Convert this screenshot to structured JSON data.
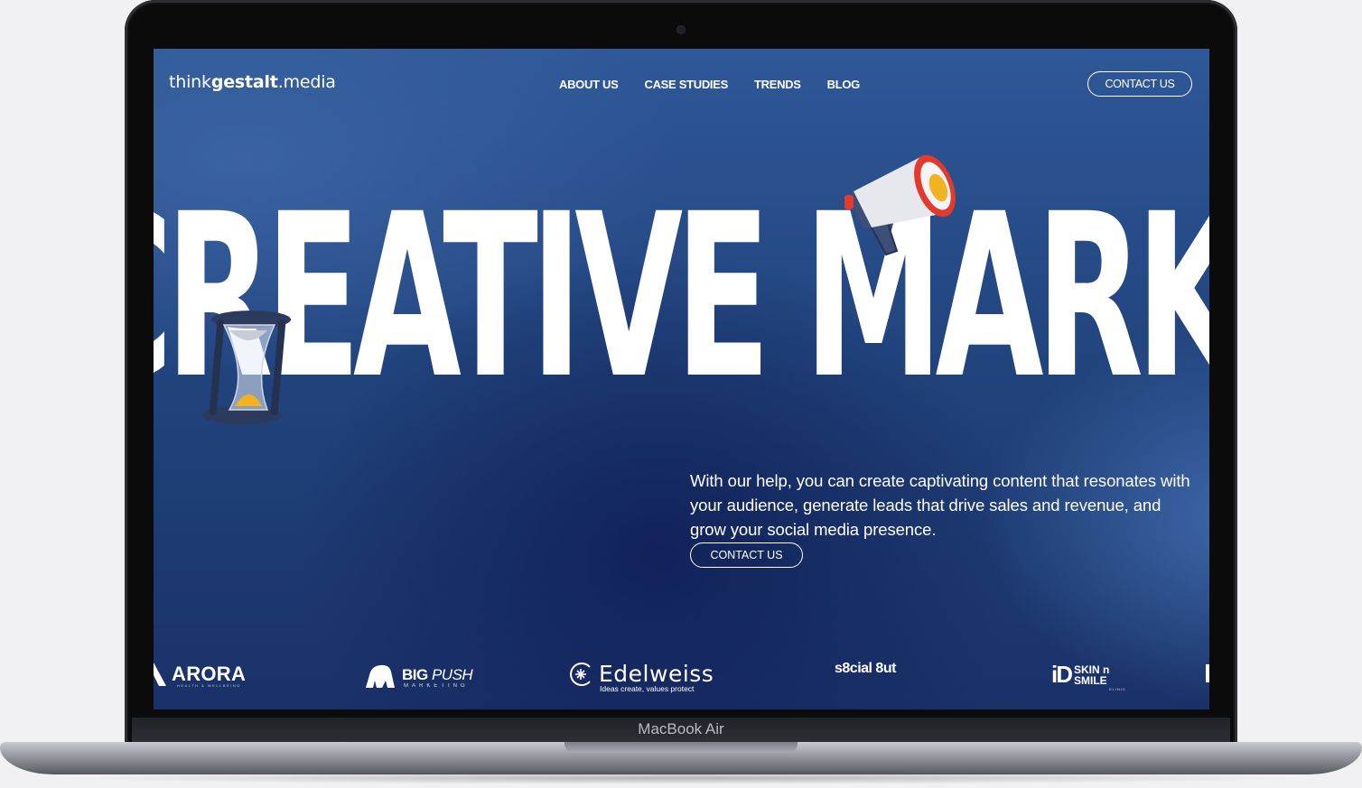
{
  "device": {
    "label": "MacBook Air"
  },
  "header": {
    "brand_prefix": "think",
    "brand_bold": "gestalt",
    "brand_suffix": ".media",
    "nav": [
      "ABOUT US",
      "CASE STUDIES",
      "TRENDS",
      "BLOG"
    ],
    "cta_label": "CONTACT US"
  },
  "hero": {
    "title": "CREATIVE MARKETING",
    "body": "With our help, you can create captivating content that resonates with your audience, generate leads that drive sales and revenue, and grow your social media presence.",
    "cta_label": "CONTACT US"
  },
  "clients": {
    "arora": {
      "name": "ARORA",
      "tagline": "HEALTH & WELLBEING"
    },
    "bigpush": {
      "name_bold": "BIG",
      "name_italic": "PUSH",
      "tagline": "MARKETING"
    },
    "edelweiss": {
      "name": "Edelweiss",
      "tagline": "Ideas create, values protect"
    },
    "social": {
      "name": "s8cial 8ut"
    },
    "skin": {
      "mark": "iD",
      "line1": "SKIN n",
      "line2": "SMILE",
      "tagline": "KLINIC"
    }
  },
  "colors": {
    "screen_top": "#2f5898",
    "screen_bottom": "#1a3168",
    "text": "#ffffff",
    "megaphone_red": "#e23b2e",
    "hourglass_sand": "#f2b321"
  },
  "icons": [
    "megaphone-icon",
    "hourglass-icon",
    "arora-logo-icon",
    "gorilla-logo-icon",
    "edelweiss-logo-icon",
    "id-logo-icon"
  ]
}
